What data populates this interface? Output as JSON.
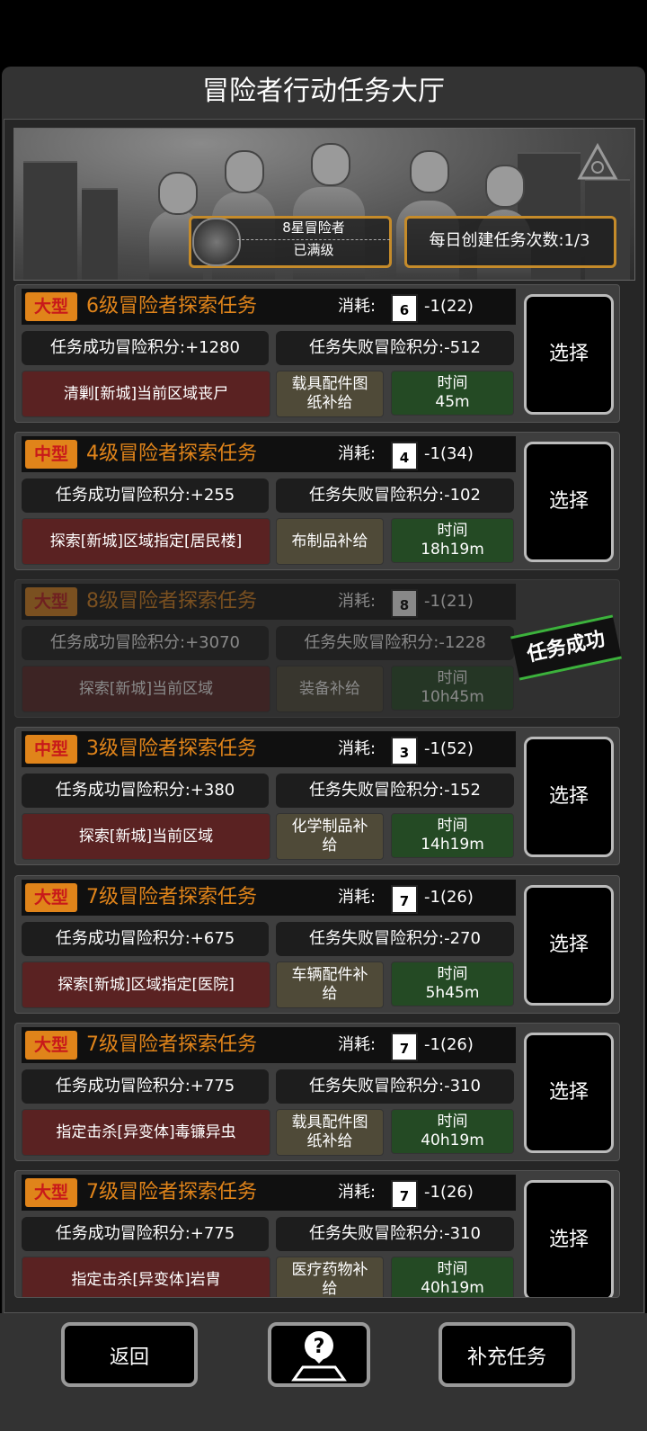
{
  "title": "冒险者行动任务大厅",
  "rank": {
    "label": "8星冒险者",
    "status": "已满级"
  },
  "daily_create": "每日创建任务次数:1/3",
  "cost_label": "消耗:",
  "select_label": "选择",
  "success_stamp": "任务成功",
  "tasks": [
    {
      "size": "大型",
      "name": "6级冒险者探索任务",
      "level": "6",
      "cost": "-1(22)",
      "success": "任务成功冒险积分:+1280",
      "fail": "任务失败冒险积分:-512",
      "mission": "清剿[新城]当前区域丧尸",
      "reward": "载具配件图纸补给",
      "time_label": "时间",
      "time": "45m",
      "completed": false
    },
    {
      "size": "中型",
      "name": "4级冒险者探索任务",
      "level": "4",
      "cost": "-1(34)",
      "success": "任务成功冒险积分:+255",
      "fail": "任务失败冒险积分:-102",
      "mission": "探索[新城]区域指定[居民楼]",
      "reward": "布制品补给",
      "time_label": "时间",
      "time": "18h19m",
      "completed": false
    },
    {
      "size": "大型",
      "name": "8级冒险者探索任务",
      "level": "8",
      "cost": "-1(21)",
      "success": "任务成功冒险积分:+3070",
      "fail": "任务失败冒险积分:-1228",
      "mission": "探索[新城]当前区域",
      "reward": "装备补给",
      "time_label": "时间",
      "time": "10h45m",
      "completed": true
    },
    {
      "size": "中型",
      "name": "3级冒险者探索任务",
      "level": "3",
      "cost": "-1(52)",
      "success": "任务成功冒险积分:+380",
      "fail": "任务失败冒险积分:-152",
      "mission": "探索[新城]当前区域",
      "reward": "化学制品补给",
      "time_label": "时间",
      "time": "14h19m",
      "completed": false
    },
    {
      "size": "大型",
      "name": "7级冒险者探索任务",
      "level": "7",
      "cost": "-1(26)",
      "success": "任务成功冒险积分:+675",
      "fail": "任务失败冒险积分:-270",
      "mission": "探索[新城]区域指定[医院]",
      "reward": "车辆配件补给",
      "time_label": "时间",
      "time": "5h45m",
      "completed": false
    },
    {
      "size": "大型",
      "name": "7级冒险者探索任务",
      "level": "7",
      "cost": "-1(26)",
      "success": "任务成功冒险积分:+775",
      "fail": "任务失败冒险积分:-310",
      "mission": "指定击杀[异变体]毒镰异虫",
      "reward": "载具配件图纸补给",
      "time_label": "时间",
      "time": "40h19m",
      "completed": false
    },
    {
      "size": "大型",
      "name": "7级冒险者探索任务",
      "level": "7",
      "cost": "-1(26)",
      "success": "任务成功冒险积分:+775",
      "fail": "任务失败冒险积分:-310",
      "mission": "指定击杀[异变体]岩胄",
      "reward": "医疗药物补给",
      "time_label": "时间",
      "time": "40h19m",
      "completed": false
    }
  ],
  "buttons": {
    "back": "返回",
    "help_icon": "help-map-icon",
    "refill": "补充任务"
  },
  "colors": {
    "accent": "#e0841a",
    "size_text": "#c8191a",
    "mission_bg": "#5a2222",
    "reward_bg": "#4f4a38",
    "time_bg": "#244a24",
    "stamp": "#3cb23c"
  }
}
